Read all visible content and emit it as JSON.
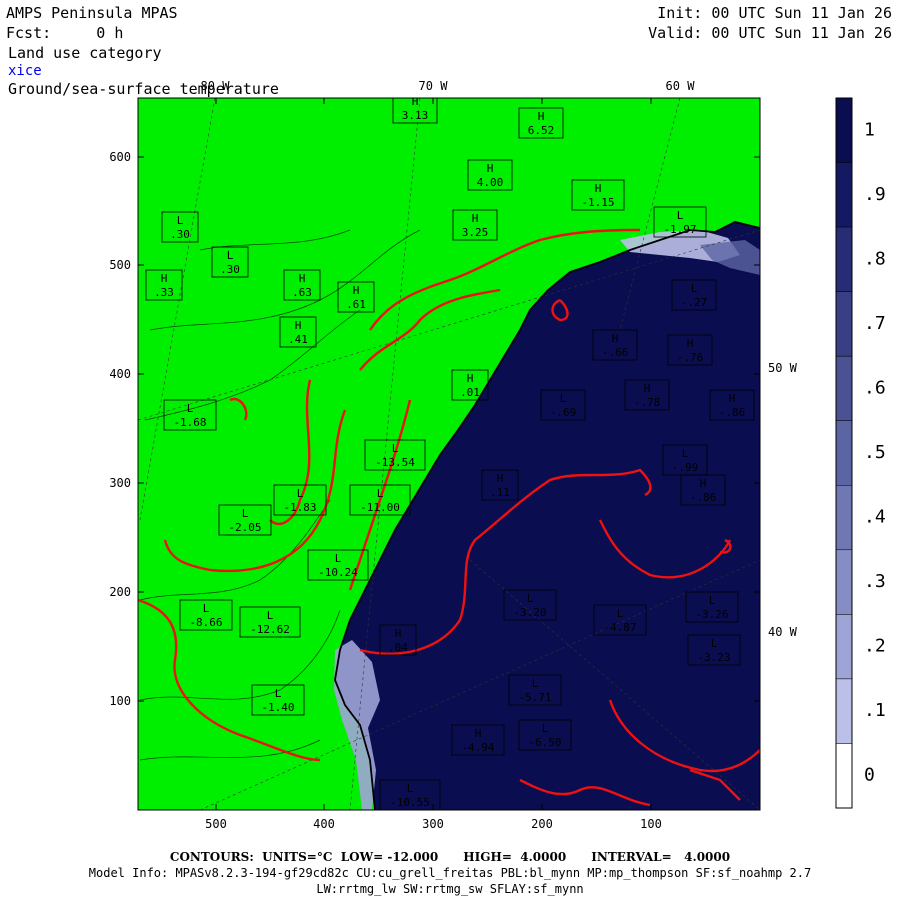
{
  "header": {
    "title": "AMPS Peninsula MPAS",
    "fcst": "Fcst:     0 h",
    "field1": "Land use category",
    "field2": "xice",
    "field3": "Ground/sea-surface temperature",
    "init": "Init: 00 UTC Sun 11 Jan 26",
    "valid": "Valid: 00 UTC Sun 11 Jan 26"
  },
  "axes": {
    "y_ticks": [
      "600",
      "500",
      "400",
      "300",
      "200",
      "100"
    ],
    "x_ticks": [
      "500",
      "400",
      "300",
      "200",
      "100"
    ],
    "lon_labels": [
      "80 W",
      "70 W",
      "60 W",
      "50 W",
      "40 W"
    ]
  },
  "colorbar": {
    "labels": [
      "1",
      ".9",
      ".8",
      ".7",
      ".6",
      ".5",
      ".4",
      ".3",
      ".2",
      ".1",
      "0"
    ],
    "colors": [
      "#0a0d50",
      "#141a62",
      "#262d74",
      "#383f84",
      "#4a5294",
      "#5c65a4",
      "#7078b4",
      "#868dc4",
      "#9ea4d6",
      "#bcc0e8",
      "#ffffff"
    ]
  },
  "map_colors": {
    "land": "#00ee00",
    "ocean": "#0a0d50",
    "contour_red": "#ee1111"
  },
  "extrema": [
    {
      "type": "H",
      "value": "3.13"
    },
    {
      "type": "H",
      "value": "6.52"
    },
    {
      "type": "H",
      "value": "4.00"
    },
    {
      "type": "H",
      "value": "3.25"
    },
    {
      "type": "L",
      "value": ".30"
    },
    {
      "type": "L",
      "value": ".30"
    },
    {
      "type": "H",
      "value": ".33"
    },
    {
      "type": "H",
      "value": ".63"
    },
    {
      "type": "H",
      "value": ".61"
    },
    {
      "type": "H",
      "value": ".41"
    },
    {
      "type": "L",
      "value": "-1.68"
    },
    {
      "type": "L",
      "value": "-13.54"
    },
    {
      "type": "L",
      "value": "-11.00"
    },
    {
      "type": "L",
      "value": "-10.24"
    },
    {
      "type": "L",
      "value": "-8.66"
    },
    {
      "type": "L",
      "value": "-12.62"
    },
    {
      "type": "L",
      "value": "-1.40"
    },
    {
      "type": "H",
      "value": ".04"
    },
    {
      "type": "L",
      "value": "-3.20"
    },
    {
      "type": "L",
      "value": "-4.87"
    },
    {
      "type": "L",
      "value": "-5.71"
    },
    {
      "type": "L",
      "value": "-3.26"
    },
    {
      "type": "L",
      "value": "-3.23"
    },
    {
      "type": "H",
      "value": "-4.94"
    },
    {
      "type": "L",
      "value": "-6.50"
    },
    {
      "type": "L",
      "value": "-10.55"
    },
    {
      "type": "H",
      "value": "-.66"
    },
    {
      "type": "H",
      "value": "-.76"
    },
    {
      "type": "L",
      "value": "-.69"
    },
    {
      "type": "H",
      "value": "-.78"
    },
    {
      "type": "H",
      "value": "-.86"
    },
    {
      "type": "L",
      "value": "-.99"
    },
    {
      "type": "H",
      "value": "-.86"
    },
    {
      "type": "H",
      "value": ".11"
    },
    {
      "type": "L",
      "value": "-.27"
    },
    {
      "type": "L",
      "value": "-1.97"
    },
    {
      "type": "H",
      "value": "-1.15"
    },
    {
      "type": "H",
      "value": ".01"
    },
    {
      "type": "L",
      "value": "-1.83"
    },
    {
      "type": "L",
      "value": "-2.05"
    }
  ],
  "footer": {
    "contours_line": "CONTOURS:  UNITS=°C  LOW= -12.000      HIGH=  4.0000      INTERVAL=   4.0000",
    "model_info": "Model Info: MPASv8.2.3-194-gf29cd82c CU:cu_grell_freitas PBL:bl_mynn MP:mp_thompson SF:sf_noahmp 2.7",
    "model_info2": "LW:rrtmg_lw SW:rrtmg_sw SFLAY:sf_mynn"
  }
}
